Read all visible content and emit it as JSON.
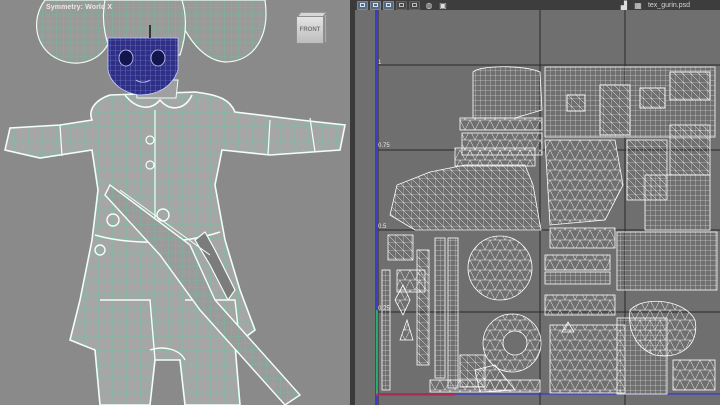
{
  "viewport3d": {
    "symmetry_label": "Symmetry: World X",
    "viewcube": {
      "face_label": "FRONT"
    }
  },
  "uv_editor": {
    "toolbar": {
      "texture_name": "tex_gurin.psd",
      "buttons": [
        "uv-grid-icon",
        "uv-shell-icon",
        "uv-checker-icon",
        "uv-pin-icon",
        "uv-frame-icon"
      ],
      "glyphs": [
        "texture-icon",
        "checker-pattern-icon",
        "sphere-icon",
        "snapshot-icon"
      ]
    },
    "axis_labels": {
      "one": "1",
      "three_quarter": "0.75",
      "half": "0.5",
      "quarter": "0.25"
    }
  }
}
